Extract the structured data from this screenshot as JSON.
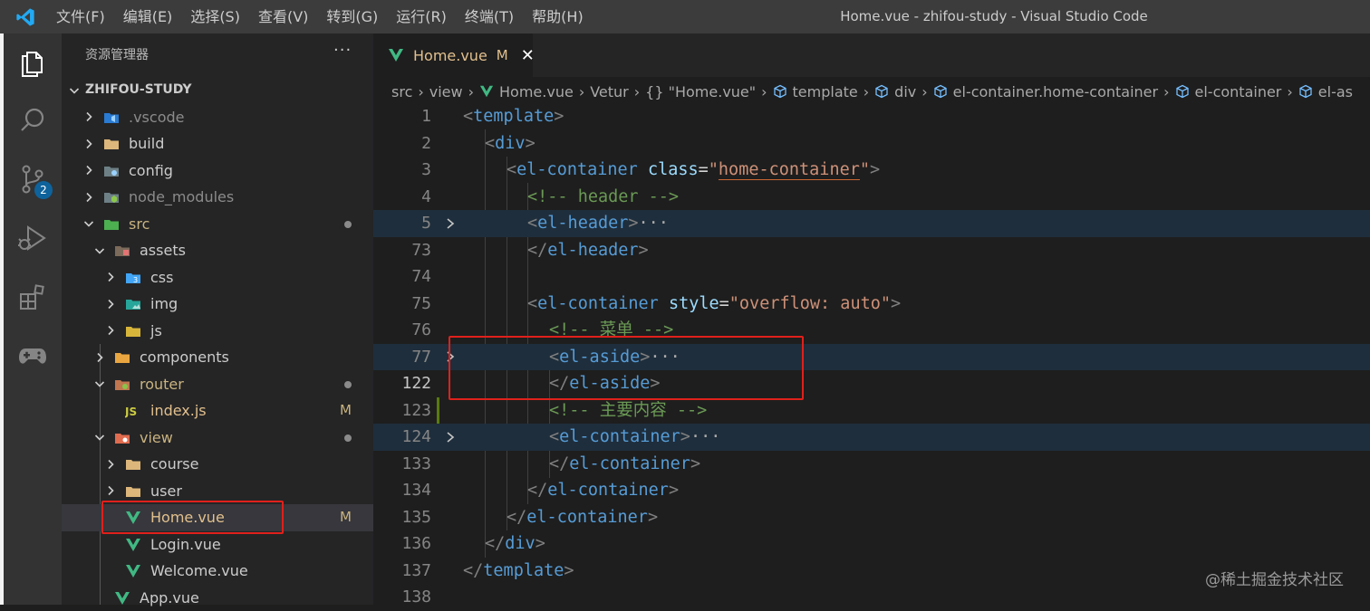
{
  "window": {
    "title": "Home.vue - zhifou-study - Visual Studio Code"
  },
  "menu": [
    "文件(F)",
    "编辑(E)",
    "选择(S)",
    "查看(V)",
    "转到(G)",
    "运行(R)",
    "终端(T)",
    "帮助(H)"
  ],
  "activity": {
    "scm_badge": "2"
  },
  "sidebar": {
    "title": "资源管理器",
    "more": "···",
    "root": "ZHIFOU-STUDY",
    "tree": [
      {
        "label": ".vscode",
        "icon": "vscode-folder-icon",
        "status": ""
      },
      {
        "label": "build",
        "icon": "folder-icon",
        "status": ""
      },
      {
        "label": "config",
        "icon": "config-folder-icon",
        "status": ""
      },
      {
        "label": "node_modules",
        "icon": "node-folder-icon",
        "status": ""
      },
      {
        "label": "src",
        "icon": "src-folder-icon",
        "status": "dot"
      },
      {
        "label": "assets",
        "icon": "assets-folder-icon",
        "status": ""
      },
      {
        "label": "css",
        "icon": "css-folder-icon",
        "status": ""
      },
      {
        "label": "img",
        "icon": "img-folder-icon",
        "status": ""
      },
      {
        "label": "js",
        "icon": "js-folder-icon",
        "status": ""
      },
      {
        "label": "components",
        "icon": "components-folder-icon",
        "status": ""
      },
      {
        "label": "router",
        "icon": "router-folder-icon",
        "status": "dot"
      },
      {
        "label": "index.js",
        "icon": "js-file-icon",
        "status": "M"
      },
      {
        "label": "view",
        "icon": "view-folder-icon",
        "status": "dot"
      },
      {
        "label": "course",
        "icon": "folder-icon",
        "status": ""
      },
      {
        "label": "user",
        "icon": "folder-icon",
        "status": ""
      },
      {
        "label": "Home.vue",
        "icon": "vue-file-icon",
        "status": "M"
      },
      {
        "label": "Login.vue",
        "icon": "vue-file-icon",
        "status": ""
      },
      {
        "label": "Welcome.vue",
        "icon": "vue-file-icon",
        "status": ""
      },
      {
        "label": "App.vue",
        "icon": "vue-file-icon",
        "status": ""
      }
    ]
  },
  "tab": {
    "label": "Home.vue",
    "modified": "M",
    "close": "✕"
  },
  "breadcrumb": [
    "src",
    "view",
    "Home.vue",
    "Vetur",
    "{} \"Home.vue\"",
    "template",
    "div",
    "el-container.home-container",
    "el-container",
    "el-as"
  ],
  "code": {
    "line_numbers": [
      "1",
      "2",
      "3",
      "4",
      "5",
      "73",
      "74",
      "75",
      "76",
      "77",
      "122",
      "123",
      "124",
      "133",
      "134",
      "135",
      "136",
      "137",
      "138"
    ],
    "l1": {
      "open": "<",
      "tag": "template",
      "close": ">"
    },
    "l2": {
      "open": "<",
      "tag": "div",
      "close": ">"
    },
    "l3": {
      "open": "<",
      "tag": "el-container",
      "attr": "class",
      "eq": "=",
      "q1": "\"",
      "val": "home-container",
      "q2": "\"",
      "close": ">"
    },
    "l4": {
      "comment": "<!-- header -->"
    },
    "l5": {
      "open": "<",
      "tag": "el-header",
      "close": ">",
      "fold": "···"
    },
    "l73": {
      "open": "</",
      "tag": "el-header",
      "close": ">"
    },
    "l75": {
      "open": "<",
      "tag": "el-container",
      "attr": "style",
      "eq": "=",
      "q1": "\"",
      "val": "overflow: auto",
      "q2": "\"",
      "close": ">"
    },
    "l76": {
      "comment": "<!-- 菜单 -->"
    },
    "l77": {
      "open": "<",
      "tag": "el-aside",
      "close": ">",
      "fold": "···"
    },
    "l122": {
      "open": "</",
      "tag": "el-aside",
      "close": ">"
    },
    "l123": {
      "comment": "<!-- 主要内容 -->"
    },
    "l124": {
      "open": "<",
      "tag": "el-container",
      "close": ">",
      "fold": "···"
    },
    "l133": {
      "open": "</",
      "tag": "el-container",
      "close": ">"
    },
    "l134": {
      "open": "</",
      "tag": "el-container",
      "close": ">"
    },
    "l135": {
      "open": "</",
      "tag": "el-container",
      "close": ">"
    },
    "l136": {
      "open": "</",
      "tag": "div",
      "close": ">"
    },
    "l137": {
      "open": "</",
      "tag": "template",
      "close": ">"
    }
  },
  "watermark": "@稀土掘金技术社区",
  "colors": {
    "accent": "#0e639c",
    "vue": "#41b883",
    "highlight": "#e0201b",
    "modified": "#e2c08d"
  }
}
